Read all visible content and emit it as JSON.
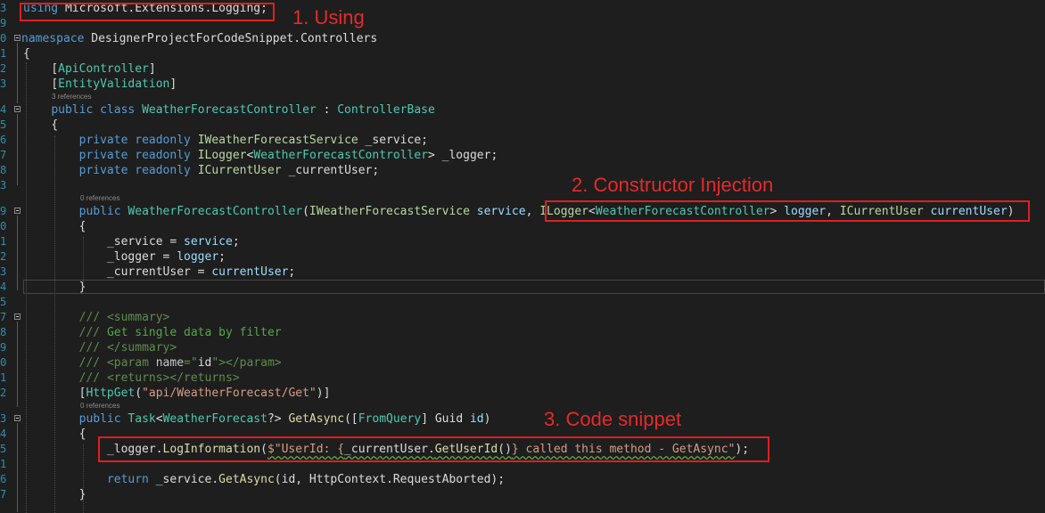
{
  "line_numbers": [
    "3",
    "9",
    "0",
    "1",
    "2",
    "3",
    "",
    "4",
    "5",
    "6",
    "7",
    "8",
    "",
    "9",
    "0",
    "1",
    "2",
    "3",
    "4",
    "5",
    "",
    "7",
    "8",
    "9",
    "0",
    "1",
    "2",
    "",
    "3",
    "4",
    "5",
    "",
    "6",
    "7"
  ],
  "codelens": {
    "class_refs": "3 references",
    "ctor_refs": "0 references",
    "method_refs": "0 references"
  },
  "code": {
    "using_kw": "using",
    "using_ns": " Microsoft.Extensions.Logging;",
    "ns_kw": "namespace",
    "ns_name": " DesignerProjectForCodeSnippet.Controllers",
    "brace_open": "{",
    "brace_close": "}",
    "attr_api": "ApiController",
    "attr_entity": "EntityValidation",
    "lb": "[",
    "rb": "]",
    "public": "public",
    "class": "class",
    "class_name": "WeatherForecastController",
    "colon": " : ",
    "base": "ControllerBase",
    "private": "private",
    "readonly": "readonly",
    "i_service": "IWeatherForecastService",
    "f_service": " _service;",
    "i_logger": "ILogger",
    "lt": "<",
    "gt": ">",
    "f_logger": " _logger;",
    "i_user": "ICurrentUser",
    "f_user": " _currentUser;",
    "ctor_name": "WeatherForecastController",
    "paren_open": "(",
    "paren_close": ")",
    "p_service": "service",
    "comma": ", ",
    "p_logger": "logger",
    "p_user": "currentUser",
    "a1_left": "_service = ",
    "a2_left": "_logger = ",
    "a3_left": "_currentUser = ",
    "semi": ";",
    "doc_slashes": "/// ",
    "doc_summary_open": "<summary>",
    "doc_text": "Get single data by filter",
    "doc_summary_close": "</summary>",
    "doc_param_open": "<param ",
    "doc_name_attr": "name",
    "doc_eq": "=",
    "doc_quote": "\"",
    "doc_id": "id",
    "doc_param_close": "></param>",
    "doc_returns": "<returns></returns>",
    "attr_httpget": "HttpGet",
    "route": "\"api/WeatherForecast/Get\"",
    "task": "Task",
    "wf": "WeatherForecast",
    "nullable": "?",
    "method": "GetAsync",
    "from_query": "FromQuery",
    "guid": " Guid ",
    "id": "id",
    "logger_field": "_logger.",
    "log_info": "LogInformation",
    "interp_start": "$\"UserId: {",
    "cur_user_field": "_currentUser.",
    "get_user_id": "GetUserId",
    "call_parens": "()",
    "interp_end": "} called this method - GetAsync\"",
    "return_kw": "return",
    "service_field": " _service.",
    "get_async": "GetAsync",
    "ret_args_a": "(id, HttpContext.RequestAborted);"
  },
  "annotations": {
    "label_1": "1. Using",
    "label_2": "2. Constructor Injection",
    "label_3": "3. Code snippet"
  },
  "colors": {
    "background": "#1e1e1e",
    "keyword": "#569cd6",
    "type": "#4ec9b0",
    "string": "#d69d85",
    "comment": "#57a64a",
    "annotation": "#e01f1f"
  }
}
